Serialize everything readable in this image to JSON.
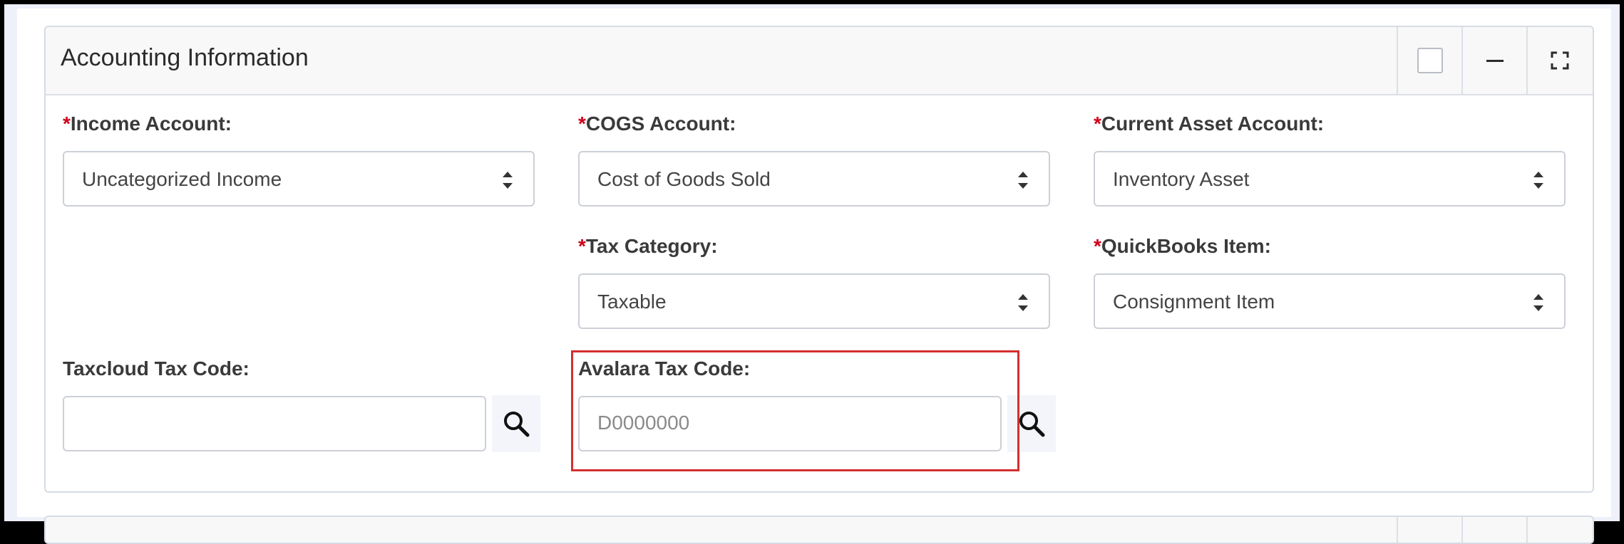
{
  "panel": {
    "title": "Accounting Information"
  },
  "fields": {
    "income_account": {
      "required": "*",
      "label": "Income Account:",
      "value": "Uncategorized Income"
    },
    "cogs_account": {
      "required": "*",
      "label": "COGS Account:",
      "value": "Cost of Goods Sold"
    },
    "current_asset_account": {
      "required": "*",
      "label": "Current Asset Account:",
      "value": "Inventory Asset"
    },
    "tax_category": {
      "required": "*",
      "label": "Tax Category:",
      "value": "Taxable"
    },
    "quickbooks_item": {
      "required": "*",
      "label": "QuickBooks Item:",
      "value": "Consignment Item"
    },
    "taxcloud_tax_code": {
      "label": "Taxcloud Tax Code:",
      "value": "",
      "placeholder": ""
    },
    "avalara_tax_code": {
      "label": "Avalara Tax Code:",
      "value": "",
      "placeholder": "D0000000"
    }
  },
  "icons": {
    "header": [
      "checkbox-icon",
      "minimize-icon",
      "expand-icon"
    ],
    "lookup": "search-icon",
    "select": "sort-arrows-icon"
  },
  "colors": {
    "required": "#d0021b",
    "highlight": "#d32f2f"
  }
}
